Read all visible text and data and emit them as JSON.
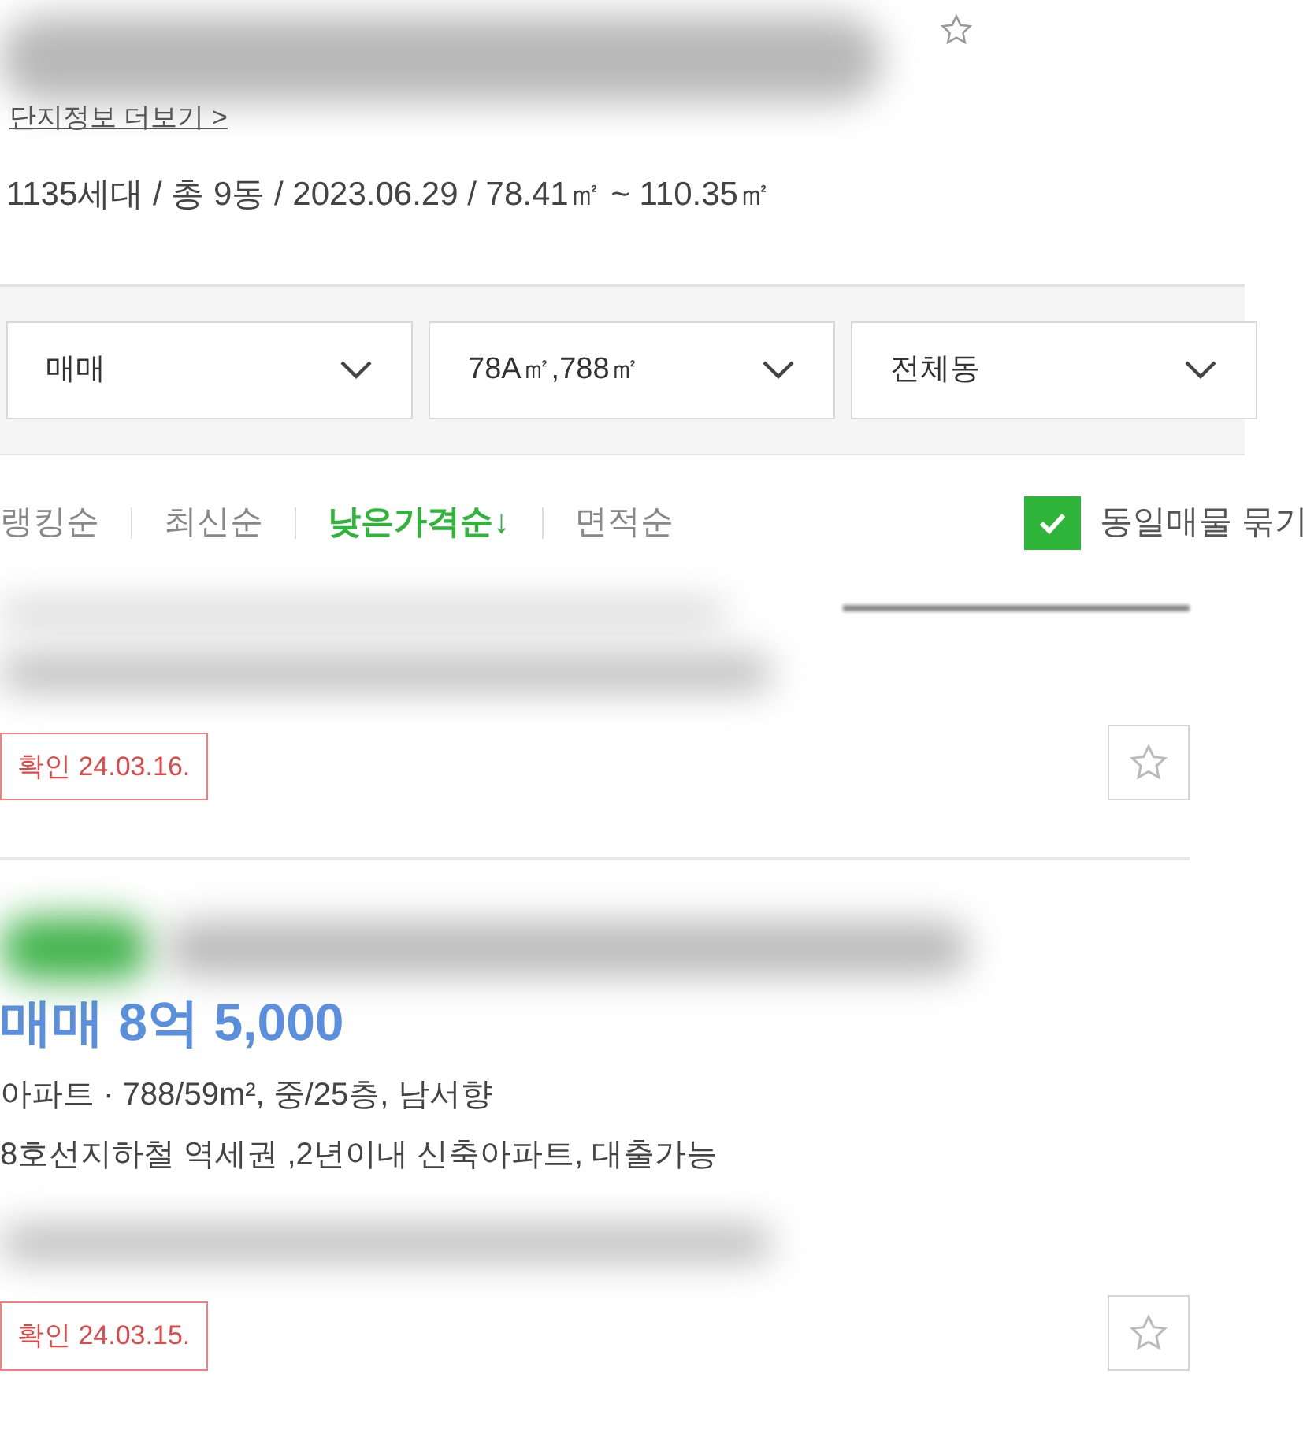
{
  "complex": {
    "link": "단지정보 더보기 >",
    "summary": "1135세대 / 총 9동 / 2023.06.29 / 78.41㎡ ~ 110.35㎡"
  },
  "filters": [
    {
      "value": "매매"
    },
    {
      "value": "78A㎡,788㎡"
    },
    {
      "value": "전체동"
    }
  ],
  "sort": [
    {
      "label": "랭킹순",
      "selected": false
    },
    {
      "label": "최신순",
      "selected": false
    },
    {
      "label": "낮은가격순↓",
      "selected": true
    },
    {
      "label": "면적순",
      "selected": false
    }
  ],
  "group_option": {
    "label": "동일매물 묶기",
    "checked": true
  },
  "listings": [
    {
      "kind": "partial",
      "confirmed": "확인 24.03.16.",
      "favorite": false
    },
    {
      "kind": "full",
      "price": "매매 8억 5,000",
      "type_line": "아파트 · 788/59m², 중/25층, 남서향",
      "desc": "8호선지하철 역세권 ,2년이내 신축아파트, 대출가능",
      "confirmed": "확인 24.03.15.",
      "favorite": false
    }
  ]
}
